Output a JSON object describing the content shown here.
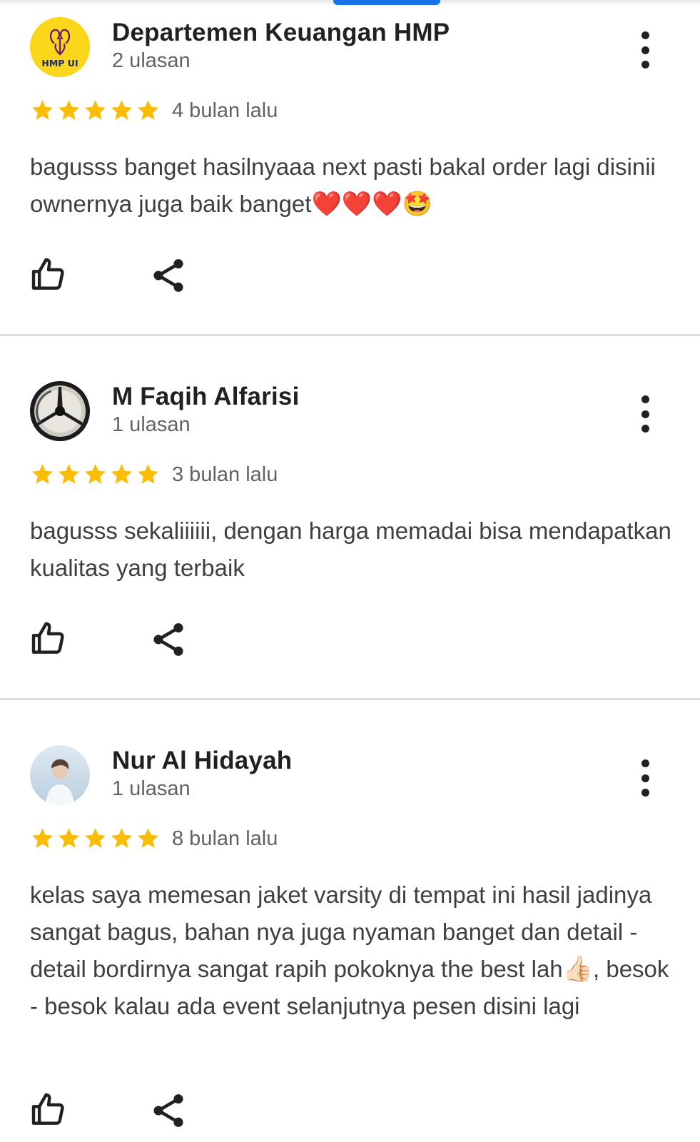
{
  "reviews": [
    {
      "author": "Departemen Keuangan HMP",
      "review_count": "2 ulasan",
      "avatar_text": "HMP UI",
      "rating": 5,
      "time": "4 bulan lalu",
      "text": "bagusss banget hasilnyaaa next pasti bakal order lagi disinii ownernya juga baik banget",
      "text_emoji": "❤️❤️❤️🤩"
    },
    {
      "author": "M Faqih Alfarisi",
      "review_count": "1 ulasan",
      "rating": 5,
      "time": "3 bulan lalu",
      "text": "bagusss sekaliiiiii, dengan harga memadai bisa mendapatkan kualitas yang terbaik"
    },
    {
      "author": "Nur Al Hidayah",
      "review_count": "1 ulasan",
      "rating": 5,
      "time": "8 bulan lalu",
      "text_part1": "kelas saya memesan jaket varsity di tempat ini hasil jadinya sangat bagus, bahan nya juga nyaman banget dan detail - detail bordirnya sangat rapih pokoknya the best lah",
      "text_emoji": "👍🏻",
      "text_part2": ", besok - besok kalau ada event selanjutnya pesen disini lagi"
    }
  ],
  "colors": {
    "star": "#fbbc04",
    "accent": "#1a73e8",
    "divider": "#dadce0",
    "secondary_text": "#5f6368",
    "avatar_hmp_bg": "#fbd61a"
  },
  "icons": {
    "like": "thumb-up-icon",
    "share": "share-icon",
    "more": "more-vert-icon",
    "star": "star-icon"
  }
}
